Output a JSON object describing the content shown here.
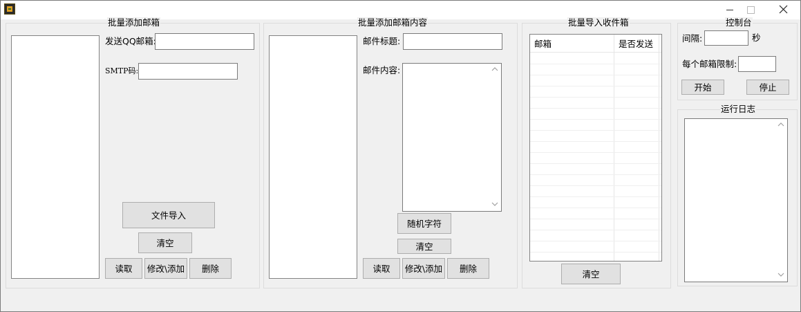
{
  "window": {
    "minimize_icon": "minimize-icon",
    "maximize_icon": "maximize-icon",
    "close_icon": "close-icon"
  },
  "sender_group": {
    "title": "批量添加邮箱",
    "qq_label": "发送QQ邮箱:",
    "qq_value": "",
    "smtp_label": "SMTP码:",
    "smtp_value": "",
    "import_button": "文件导入",
    "clear_button": "清空",
    "read_button": "读取",
    "modify_button": "修改\\添加",
    "delete_button": "删除"
  },
  "content_group": {
    "title": "批量添加邮箱内容",
    "subject_label": "邮件标题:",
    "subject_value": "",
    "body_label": "邮件内容:",
    "body_value": "",
    "random_button": "随机字符",
    "clear_button": "清空",
    "read_button": "读取",
    "modify_button": "修改\\添加",
    "delete_button": "删除"
  },
  "recipients_group": {
    "title": "批量导入收件箱",
    "columns": [
      "邮箱",
      "是否发送"
    ],
    "rows": [],
    "clear_button": "清空"
  },
  "control_group": {
    "title": "控制台",
    "interval_label": "间隔:",
    "interval_value": "",
    "seconds_label": "秒",
    "limit_label": "每个邮箱限制:",
    "limit_value": "",
    "start_button": "开始",
    "stop_button": "停止"
  },
  "log_group": {
    "title": "运行日志",
    "log_text": ""
  },
  "colors": {
    "window_bg": "#f0f0f0",
    "button_bg": "#e1e1e1",
    "field_bg": "#ffffff"
  }
}
